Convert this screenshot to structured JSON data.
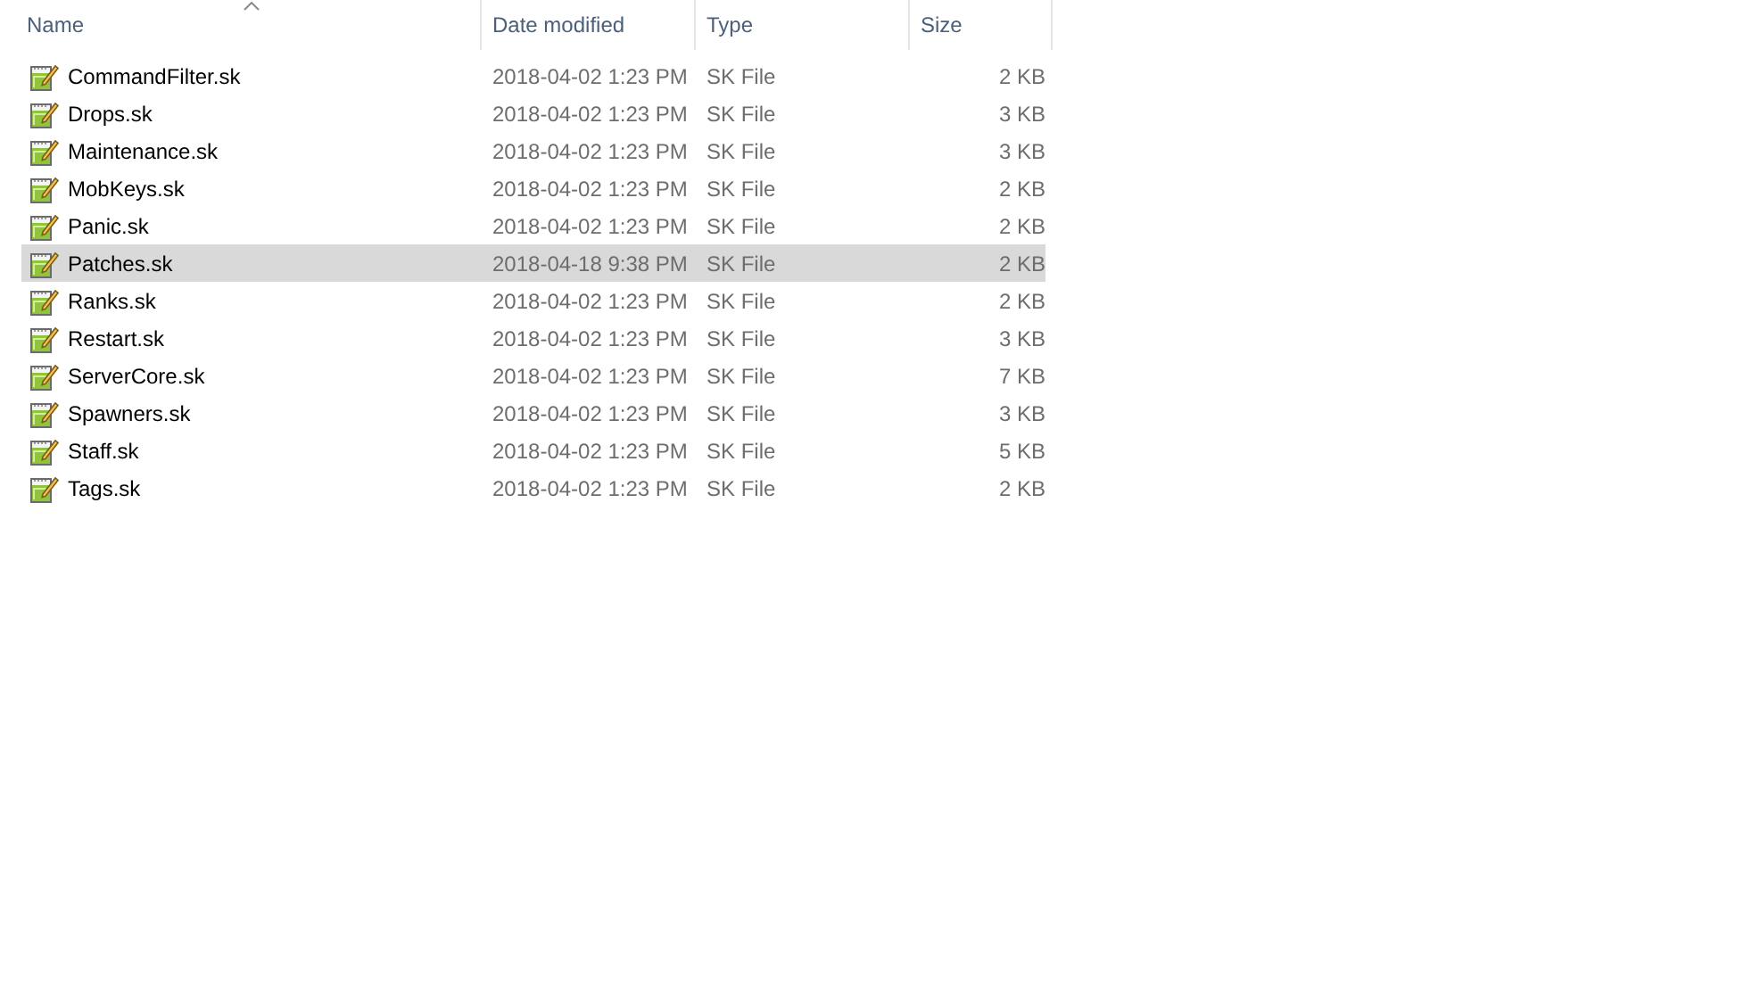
{
  "columns": [
    {
      "label": "Name",
      "sorted": true
    },
    {
      "label": "Date modified",
      "sorted": false
    },
    {
      "label": "Type",
      "sorted": false
    },
    {
      "label": "Size",
      "sorted": false
    }
  ],
  "rows": [
    {
      "name": "CommandFilter.sk",
      "date": "2018-04-02 1:23 PM",
      "type": "SK File",
      "size": "2 KB",
      "selected": false
    },
    {
      "name": "Drops.sk",
      "date": "2018-04-02 1:23 PM",
      "type": "SK File",
      "size": "3 KB",
      "selected": false
    },
    {
      "name": "Maintenance.sk",
      "date": "2018-04-02 1:23 PM",
      "type": "SK File",
      "size": "3 KB",
      "selected": false
    },
    {
      "name": "MobKeys.sk",
      "date": "2018-04-02 1:23 PM",
      "type": "SK File",
      "size": "2 KB",
      "selected": false
    },
    {
      "name": "Panic.sk",
      "date": "2018-04-02 1:23 PM",
      "type": "SK File",
      "size": "2 KB",
      "selected": false
    },
    {
      "name": "Patches.sk",
      "date": "2018-04-18 9:38 PM",
      "type": "SK File",
      "size": "2 KB",
      "selected": true
    },
    {
      "name": "Ranks.sk",
      "date": "2018-04-02 1:23 PM",
      "type": "SK File",
      "size": "2 KB",
      "selected": false
    },
    {
      "name": "Restart.sk",
      "date": "2018-04-02 1:23 PM",
      "type": "SK File",
      "size": "3 KB",
      "selected": false
    },
    {
      "name": "ServerCore.sk",
      "date": "2018-04-02 1:23 PM",
      "type": "SK File",
      "size": "7 KB",
      "selected": false
    },
    {
      "name": "Spawners.sk",
      "date": "2018-04-02 1:23 PM",
      "type": "SK File",
      "size": "3 KB",
      "selected": false
    },
    {
      "name": "Staff.sk",
      "date": "2018-04-02 1:23 PM",
      "type": "SK File",
      "size": "5 KB",
      "selected": false
    },
    {
      "name": "Tags.sk",
      "date": "2018-04-02 1:23 PM",
      "type": "SK File",
      "size": "2 KB",
      "selected": false
    }
  ]
}
